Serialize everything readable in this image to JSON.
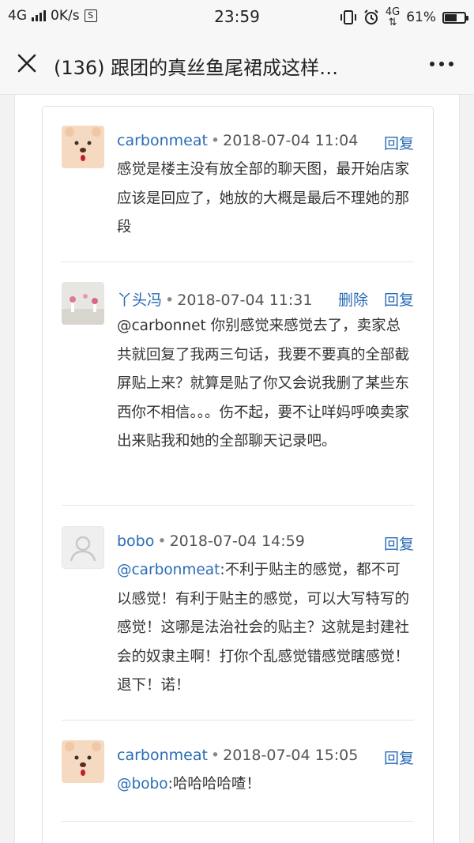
{
  "status_bar": {
    "network": "4G",
    "speed": "0K/s",
    "sim_badge": "S",
    "time": "23:59",
    "net_type": "4G",
    "battery": "61%",
    "battery_level": 0.61
  },
  "header": {
    "title": "(136) 跟团的真丝鱼尾裙成这样…"
  },
  "comments": [
    {
      "user": "carbonmeat",
      "date": "2018-07-04 11:04",
      "reply_label": "回复",
      "body": "感觉是楼主没有放全部的聊天图，最开始店家应该是回应了，她放的大概是最后不理她的那段"
    },
    {
      "user": "丫头冯",
      "date": "2018-07-04 11:31",
      "delete_label": "删除",
      "reply_label": "回复",
      "body": "@carbonnet 你别感觉来感觉去了，卖家总共就回复了我两三句话，我要不要真的全部截屏贴上来？就算是贴了你又会说我删了某些东西你不相信。。。伤不起，要不让咩妈呼唤卖家出来贴我和她的全部聊天记录吧。"
    },
    {
      "user": "bobo",
      "date": "2018-07-04 14:59",
      "reply_label": "回复",
      "mention": "@carbonmeat",
      "body": ":不利于贴主的感觉，都不可以感觉！有利于贴主的感觉，可以大写特写的感觉！这哪是法治社会的贴主？这就是封建社会的奴隶主啊！打你个乱感觉错感觉瞎感觉！退下！诺！"
    },
    {
      "user": "carbonmeat",
      "date": "2018-07-04 15:05",
      "reply_label": "回复",
      "mention": "@bobo",
      "body": ":哈哈哈哈喳！"
    }
  ],
  "separator": "•",
  "colors": {
    "link": "#2a6cb5",
    "text": "#333333",
    "background": "#f2f2f2"
  }
}
